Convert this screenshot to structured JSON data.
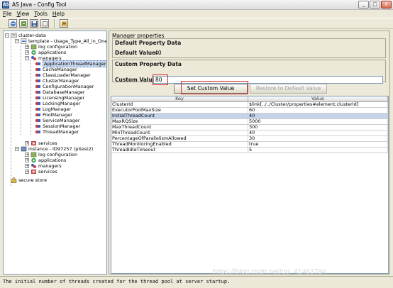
{
  "window": {
    "title": "AS Java - Config Tool",
    "app_icon": "AS",
    "controls": [
      "_",
      "□",
      "X"
    ]
  },
  "menu": [
    "File",
    "View",
    "Tools",
    "Help"
  ],
  "toolbar": {
    "icons": [
      "connect-icon",
      "refresh-icon",
      "save-icon",
      "import-icon",
      "export-icon"
    ]
  },
  "tree": {
    "root": "cluster-data",
    "template": "template - Usage_Type_All_in_One",
    "template_children": [
      "log configuration",
      "applications",
      "managers"
    ],
    "managers": [
      "ApplicationThreadManager",
      "CacheManager",
      "ClassLoaderManager",
      "ClusterManager",
      "ConfigurationManager",
      "DatabaseManager",
      "LicensingManager",
      "LockingManager",
      "LogManager",
      "PoolManager",
      "ServiceManager",
      "SessionManager",
      "ThreadManager"
    ],
    "services": "services",
    "instance": "instance - ID97257 (pitest2)",
    "instance_children": [
      "log configuration",
      "applications",
      "managers",
      "services"
    ],
    "secure_store": "secure store"
  },
  "props": {
    "title": "Manager properties",
    "default_group": "Default Property Data",
    "default_label": "Default Value:",
    "default_value": "40",
    "custom_group": "Custom Property Data",
    "custom_label": "Custom Value:",
    "custom_value": "80",
    "set_button": "Set Custom Value",
    "restore_button": "Restore to Default Value"
  },
  "table": {
    "headers": [
      "Key",
      "Value"
    ],
    "rows": [
      [
        "ClusterId",
        "$link[../../Cluster/properties#element.clusterId]"
      ],
      [
        "ExecutorPoolMaxSize",
        "60"
      ],
      [
        "InitialThreadCount",
        "40"
      ],
      [
        "MaxRQSize",
        "5000"
      ],
      [
        "MaxThreadCount",
        "300"
      ],
      [
        "MinThreadCount",
        "40"
      ],
      [
        "PercentageOfParallelismAllowed",
        "30"
      ],
      [
        "ThreadMonitoringEnabled",
        "true"
      ],
      [
        "ThreadIdleTimeout",
        "5"
      ]
    ],
    "selected_row": 2
  },
  "status": "The initial number of threads created for the thread pool at server startup.",
  "watermark": "https://blog.csdn.net/qq_41463794",
  "colors": {
    "highlight": "#d8282a",
    "selection": "#c5d3ea",
    "background": "#ece9d8"
  }
}
